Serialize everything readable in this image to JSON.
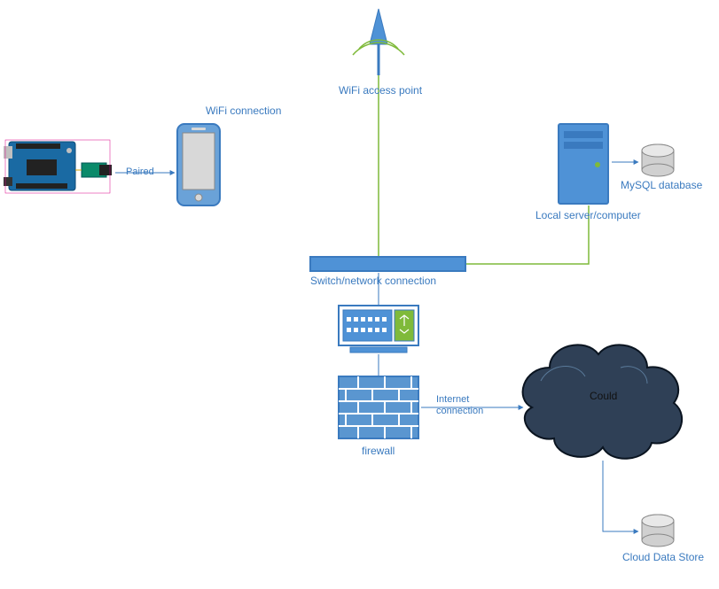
{
  "labels": {
    "wifi_connection": "WiFi connection",
    "paired": "Paired",
    "wifi_ap": "WiFi access point",
    "local_server": "Local server/computer",
    "mysql": "MySQL database",
    "switch": "Switch/network connection",
    "firewall": "firewall",
    "internet": "Internet\nconnection",
    "cloud": "Could",
    "cloud_store": "Cloud Data Store"
  },
  "colors": {
    "blue": "#3a7abf",
    "blue_fill": "#4f92d6",
    "green": "#7fba3a",
    "dark_cloud": "#2f4056",
    "db_fill": "#d0d0d0",
    "db_stroke": "#888888"
  }
}
